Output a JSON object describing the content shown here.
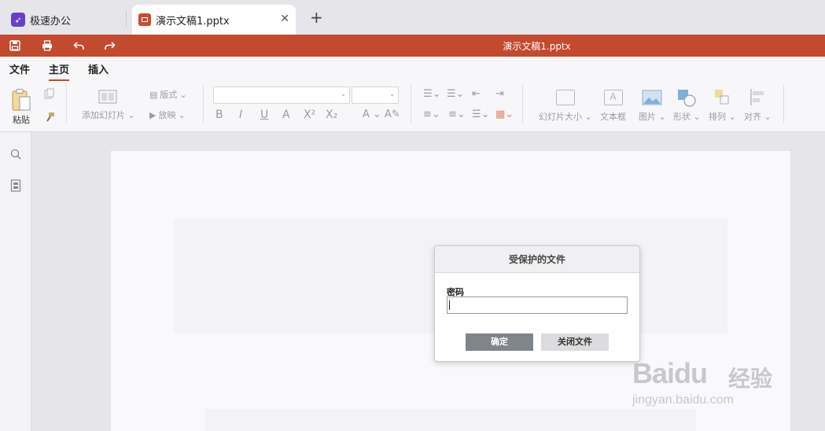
{
  "tabs": {
    "home_label": "极速办公",
    "doc_label": "演示文稿1.pptx"
  },
  "titlebar": {
    "title": "演示文稿1.pptx"
  },
  "menu": {
    "items": [
      "文件",
      "主页",
      "插入"
    ],
    "active": "主页"
  },
  "toolbar": {
    "paste": "粘贴",
    "add_slide": "添加幻灯片",
    "layout": "版式",
    "play": "放映",
    "slide_size": "幻灯片大小",
    "textbox": "文本框",
    "picture": "图片",
    "shape": "形状",
    "arrange": "排列",
    "align": "对齐"
  },
  "dialog": {
    "title": "受保护的文件",
    "password_label": "密码",
    "password_value": "",
    "ok_label": "确定",
    "close_label": "关闭文件"
  },
  "watermark": {
    "brand": "Baidu",
    "brand_cn": "经验",
    "url": "jingyan.baidu.com"
  },
  "colors": {
    "accent": "#c24a2f",
    "app_logo": "#6a3fc8"
  }
}
